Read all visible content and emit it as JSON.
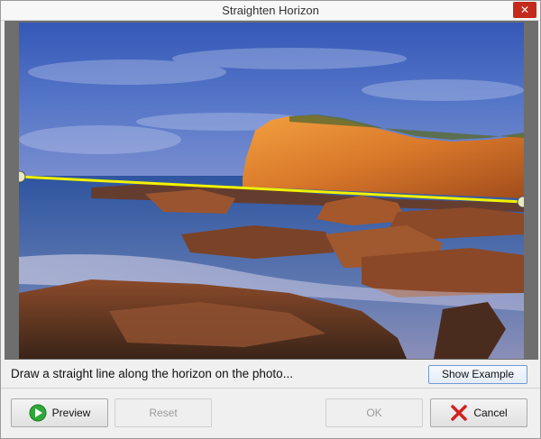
{
  "window": {
    "title": "Straighten Horizon",
    "close_glyph": "✕"
  },
  "instruction": {
    "text": "Draw a straight line along the horizon on the photo..."
  },
  "buttons": {
    "show_example": "Show Example",
    "preview": "Preview",
    "reset": "Reset",
    "ok": "OK",
    "cancel": "Cancel"
  },
  "icons": {
    "preview": "play-arrow-icon",
    "cancel": "red-x-icon"
  },
  "colors": {
    "horizon_line": "#f2f200",
    "handle": "#e8e8c0",
    "close_button": "#c42b1c",
    "preview_icon": "#2fa838",
    "cancel_icon": "#d42020"
  }
}
